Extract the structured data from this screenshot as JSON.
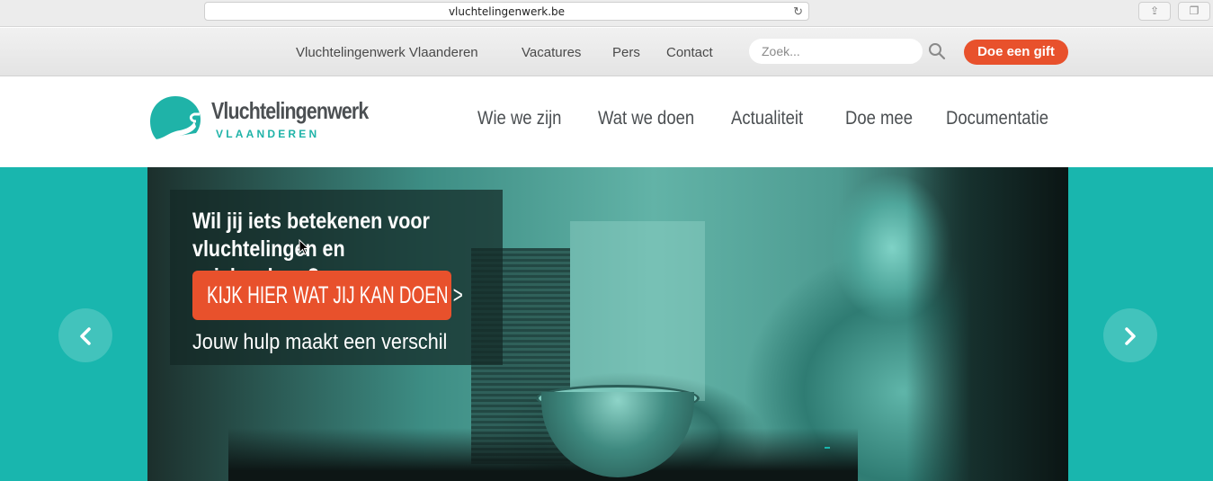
{
  "browser": {
    "url": "vluchtelingenwerk.be",
    "reload_icon": "reload-icon",
    "share_icon": "share-icon",
    "tabs_icon": "tabs-icon"
  },
  "utility_nav": {
    "items": [
      "Vluchtelingenwerk Vlaanderen",
      "Vacatures",
      "Pers",
      "Contact"
    ],
    "search_placeholder": "Zoek...",
    "search_icon": "search-icon",
    "gift_label": "Doe een gift"
  },
  "logo": {
    "title": "Vluchtelingenwerk",
    "subtitle": "VLAANDEREN"
  },
  "main_nav": {
    "items": [
      "Wie we zijn",
      "Wat we doen",
      "Actualiteit",
      "Doe mee",
      "Documentatie"
    ]
  },
  "hero": {
    "title": "Wil jij iets betekenen voor vluchtelingen en asielzoekers?",
    "cta_label": "KIJK HIER WAT JIJ KAN DOEN  >",
    "subtitle": "Jouw hulp maakt een verschil",
    "prev_icon": "chevron-left-icon",
    "next_icon": "chevron-right-icon"
  },
  "colors": {
    "accent": "#e8512c",
    "brand_teal": "#19b6ae",
    "text_dark": "#4b4f52"
  }
}
